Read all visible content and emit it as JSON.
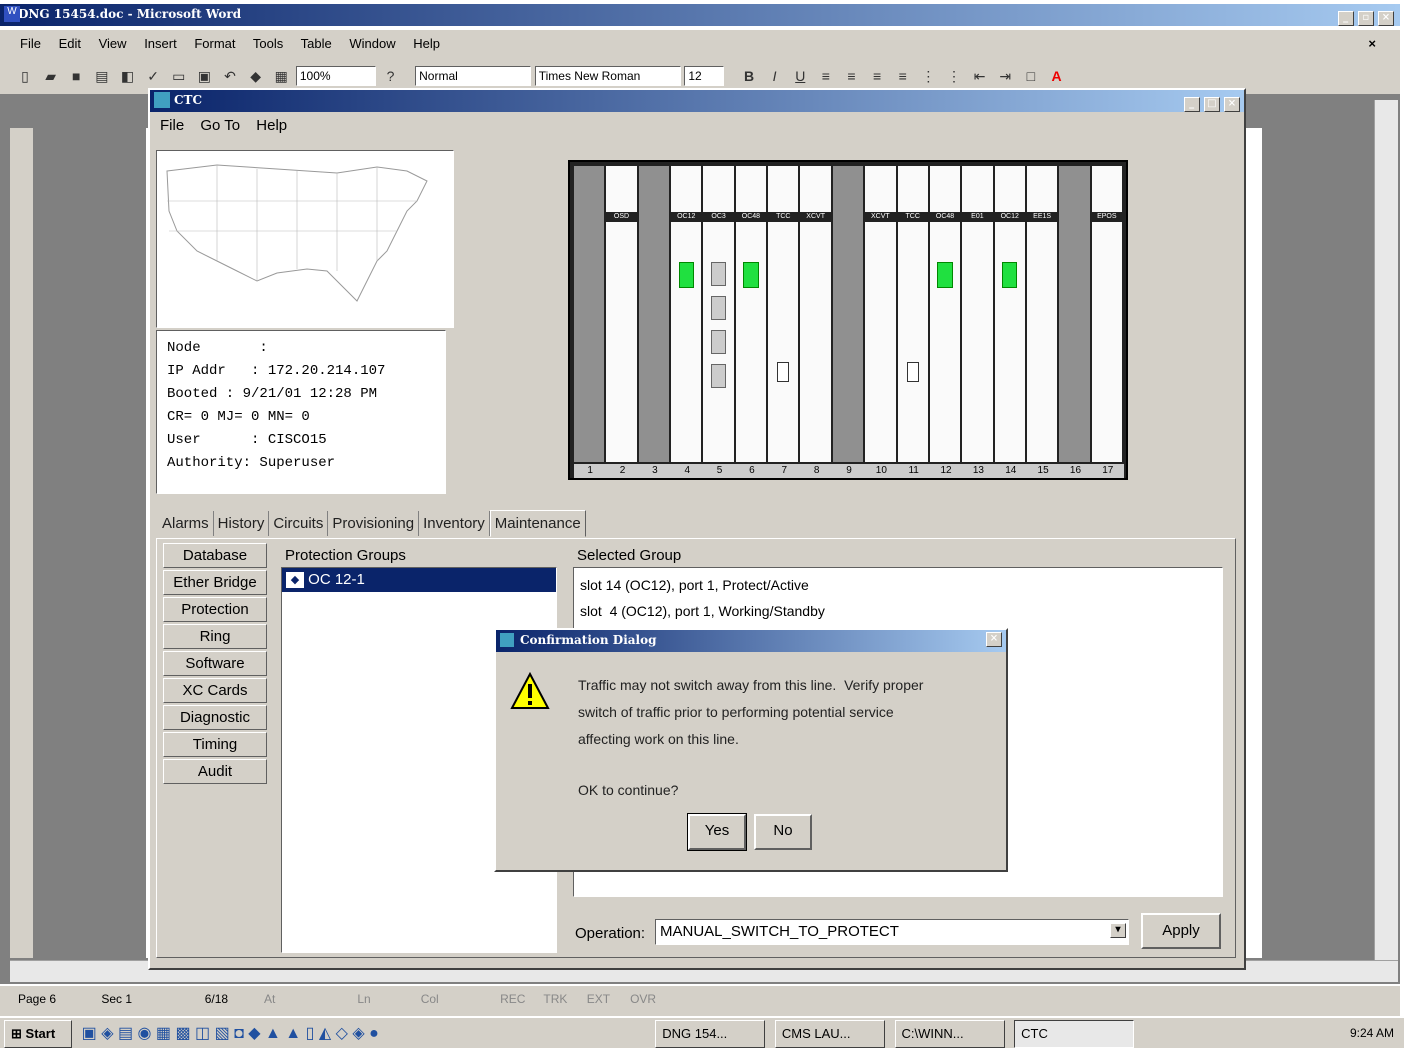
{
  "word": {
    "title": "DNG 15454.doc - Microsoft Word",
    "menu": [
      "File",
      "Edit",
      "View",
      "Insert",
      "Format",
      "Tools",
      "Table",
      "Window",
      "Help"
    ],
    "zoom": "100%",
    "style": "Normal",
    "font": "Times New Roman",
    "size": "12",
    "status": {
      "page": "Page 6",
      "sec": "Sec 1",
      "pos": "6/18",
      "at": "At",
      "ln": "Ln",
      "col": "Col",
      "rec": "REC",
      "trk": "TRK",
      "ext": "EXT",
      "ovr": "OVR"
    }
  },
  "ctc": {
    "title": "CTC",
    "menu": [
      "File",
      "Go To",
      "Help"
    ],
    "node_info": [
      "Node       :",
      "IP Addr   : 172.20.214.107",
      "Booted : 9/21/01 12:28 PM",
      "CR= 0 MJ= 0 MN= 0",
      "User      : CISCO15",
      "Authority: Superuser"
    ],
    "card_labels": [
      "",
      "OSD",
      "",
      "OC12",
      "OC3",
      "OC48",
      "TCC",
      "XCVT",
      "",
      "XCVT",
      "TCC",
      "OC48",
      "E01",
      "OC12",
      "EE1S",
      "",
      "EPOS"
    ],
    "slot_numbers": [
      "1",
      "2",
      "3",
      "4",
      "5",
      "6",
      "7",
      "8",
      "9",
      "10",
      "11",
      "12",
      "13",
      "14",
      "15",
      "16",
      "17"
    ],
    "tabs": [
      "Alarms",
      "History",
      "Circuits",
      "Provisioning",
      "Inventory",
      "Maintenance"
    ],
    "side_buttons": [
      "Database",
      "Ether Bridge",
      "Protection",
      "Ring",
      "Software",
      "XC Cards",
      "Diagnostic",
      "Timing",
      "Audit"
    ],
    "protection_groups_label": "Protection Groups",
    "protection_groups": [
      "OC 12-1"
    ],
    "selected_group_label": "Selected Group",
    "selected_group": [
      "slot 14 (OC12), port 1, Protect/Active",
      "slot  4 (OC12), port 1, Working/Standby"
    ],
    "operation_label": "Operation:",
    "operation_value": "MANUAL_SWITCH_TO_PROTECT",
    "apply_label": "Apply"
  },
  "dialog": {
    "title": "Confirmation Dialog",
    "lines": [
      "Traffic may not switch away from this line.  Verify proper",
      "switch of traffic prior to performing potential service",
      "affecting work on this line."
    ],
    "question": "OK to continue?",
    "yes": "Yes",
    "no": "No"
  },
  "taskbar": {
    "start": "Start",
    "tasks": [
      "DNG 154...",
      "CMS LAU...",
      "C:\\WINN...",
      "CTC"
    ],
    "clock": "9:24 AM"
  }
}
